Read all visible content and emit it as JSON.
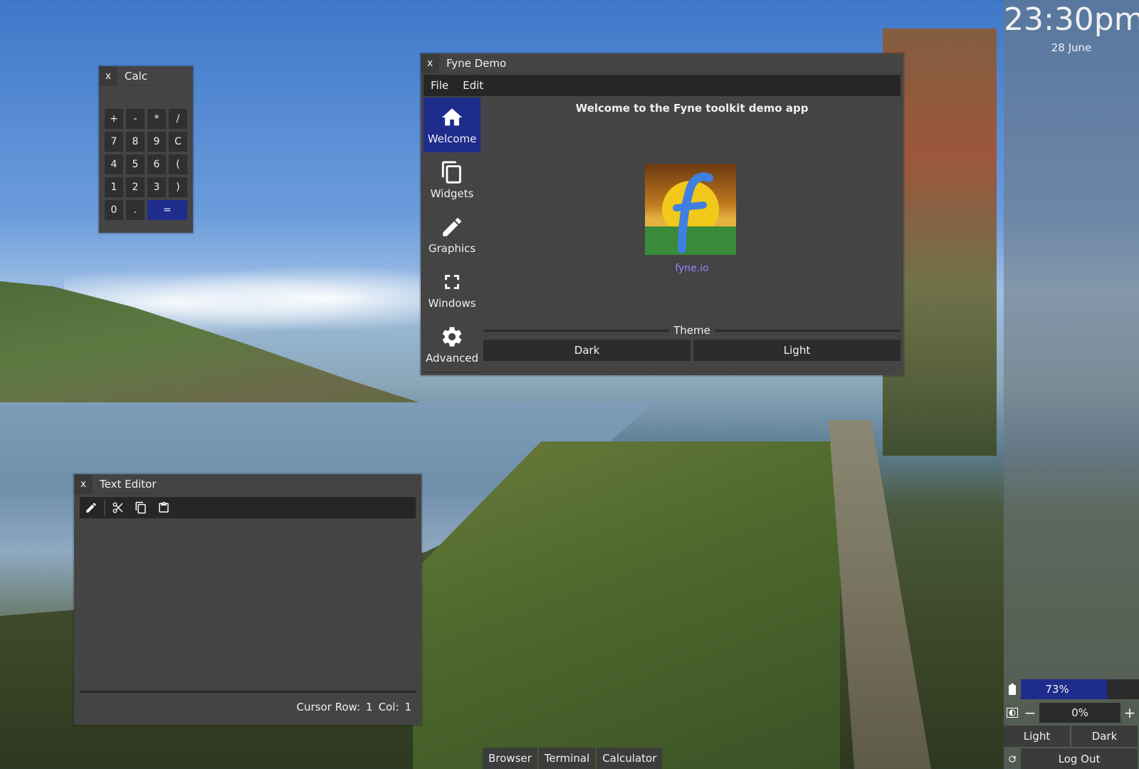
{
  "calc": {
    "close_label": "x",
    "title": "Calc",
    "keys": [
      {
        "label": "+",
        "name": "calc-key-plus"
      },
      {
        "label": "-",
        "name": "calc-key-minus"
      },
      {
        "label": "*",
        "name": "calc-key-multiply"
      },
      {
        "label": "/",
        "name": "calc-key-divide"
      },
      {
        "label": "7",
        "name": "calc-key-7"
      },
      {
        "label": "8",
        "name": "calc-key-8"
      },
      {
        "label": "9",
        "name": "calc-key-9"
      },
      {
        "label": "C",
        "name": "calc-key-clear"
      },
      {
        "label": "4",
        "name": "calc-key-4"
      },
      {
        "label": "5",
        "name": "calc-key-5"
      },
      {
        "label": "6",
        "name": "calc-key-6"
      },
      {
        "label": "(",
        "name": "calc-key-open-paren"
      },
      {
        "label": "1",
        "name": "calc-key-1"
      },
      {
        "label": "2",
        "name": "calc-key-2"
      },
      {
        "label": "3",
        "name": "calc-key-3"
      },
      {
        "label": ")",
        "name": "calc-key-close-paren"
      },
      {
        "label": "0",
        "name": "calc-key-0"
      },
      {
        "label": ".",
        "name": "calc-key-dot"
      },
      {
        "label": "=",
        "name": "calc-key-equals"
      }
    ]
  },
  "fyne_demo": {
    "close_label": "x",
    "title": "Fyne Demo",
    "menu": [
      "File",
      "Edit"
    ],
    "sidebar": [
      {
        "label": "Welcome",
        "icon": "home-icon",
        "active": true
      },
      {
        "label": "Widgets",
        "icon": "copy-icon",
        "active": false
      },
      {
        "label": "Graphics",
        "icon": "pencil-icon",
        "active": false
      },
      {
        "label": "Windows",
        "icon": "fullscreen-icon",
        "active": false
      },
      {
        "label": "Advanced",
        "icon": "gear-icon",
        "active": false
      }
    ],
    "welcome_text": "Welcome to the Fyne toolkit demo app",
    "link_text": "fyne.io",
    "theme_label": "Theme",
    "theme_buttons": [
      "Dark",
      "Light"
    ],
    "colors": {
      "accent": "#1e2d8c",
      "link": "#8f86ff"
    }
  },
  "text_editor": {
    "close_label": "x",
    "title": "Text Editor",
    "toolbar": [
      "pencil-icon",
      "scissors-icon",
      "copy-icon",
      "clipboard-icon"
    ],
    "status": {
      "row_label": "Cursor Row:",
      "row_value": "1",
      "col_label": "Col:",
      "col_value": "1"
    }
  },
  "side_panel": {
    "clock": "23:30pm",
    "date": "28  June",
    "battery_icon": "battery-icon",
    "battery_percent_text": "73%",
    "battery_level": 0.73,
    "brightness_icon": "brightness-icon",
    "brightness_minus": "−",
    "brightness_value": "0%",
    "brightness_plus": "+",
    "theme_light": "Light",
    "theme_dark": "Dark",
    "refresh_icon": "refresh-icon",
    "logout_label": "Log Out"
  },
  "taskbar": [
    "Browser",
    "Terminal",
    "Calculator"
  ]
}
